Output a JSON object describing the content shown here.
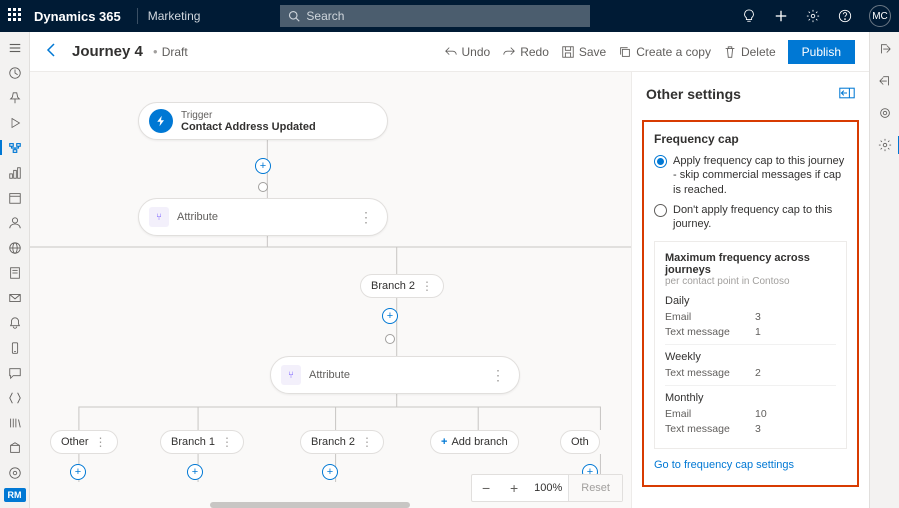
{
  "header": {
    "brand": "Dynamics 365",
    "app": "Marketing",
    "search_placeholder": "Search",
    "avatar": "MC"
  },
  "command": {
    "title": "Journey 4",
    "status": "Draft",
    "undo": "Undo",
    "redo": "Redo",
    "save": "Save",
    "copy": "Create a copy",
    "delete": "Delete",
    "publish": "Publish"
  },
  "canvas": {
    "trigger_label": "Trigger",
    "trigger_name": "Contact Address Updated",
    "attribute": "Attribute",
    "branch2": "Branch 2",
    "other": "Other",
    "branch1": "Branch 1",
    "add_branch": "Add branch",
    "oth": "Oth",
    "zoom": "100%",
    "reset": "Reset"
  },
  "panel": {
    "title": "Other settings",
    "freq_title": "Frequency cap",
    "option_apply": "Apply frequency cap to this journey - skip commercial messages if cap is reached.",
    "option_dont": "Don't apply frequency cap to this journey.",
    "max_title": "Maximum frequency across journeys",
    "max_sub": "per contact point in Contoso",
    "daily": "Daily",
    "weekly": "Weekly",
    "monthly": "Monthly",
    "email": "Email",
    "text_msg": "Text message",
    "vals": {
      "daily_email": "3",
      "daily_text": "1",
      "weekly_text": "2",
      "monthly_email": "10",
      "monthly_text": "3"
    },
    "go_link": "Go to frequency cap settings"
  },
  "rail_chip": "RM"
}
